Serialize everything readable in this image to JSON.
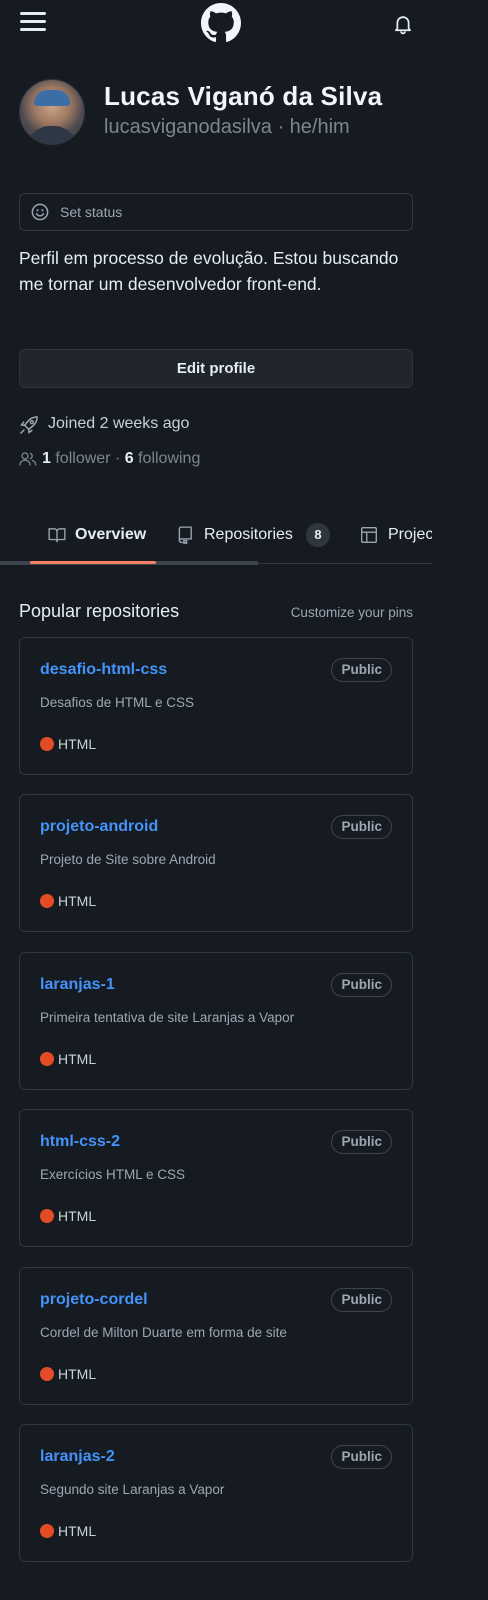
{
  "header": {
    "menu_icon": "hamburger-menu-icon",
    "logo_icon": "github-octocat-icon",
    "notifications_icon": "bell-icon"
  },
  "profile": {
    "name": "Lucas Viganó da Silva",
    "login_line": "lucasviganodasilva · he/him",
    "status_label": "Set status",
    "bio": "Perfil em processo de evolução. Estou buscando me tornar um desenvolvedor front-end.",
    "edit_button": "Edit profile",
    "joined": "Joined 2 weeks ago",
    "followers_count": "1",
    "followers_label": "follower",
    "following_count": "6",
    "following_label": "following"
  },
  "tabs": [
    {
      "label": "Overview",
      "icon": "book-icon",
      "selected": true
    },
    {
      "label": "Repositories",
      "icon": "repo-icon",
      "count": "8"
    },
    {
      "label": "Projec",
      "icon": "table-icon"
    }
  ],
  "popular": {
    "title": "Popular repositories",
    "customize": "Customize your pins",
    "repos": [
      {
        "name": "desafio-html-css",
        "visibility": "Public",
        "description": "Desafios de HTML e CSS",
        "language": "HTML"
      },
      {
        "name": "projeto-android",
        "visibility": "Public",
        "description": "Projeto de Site sobre Android",
        "language": "HTML"
      },
      {
        "name": "laranjas-1",
        "visibility": "Public",
        "description": "Primeira tentativa de site Laranjas a Vapor",
        "language": "HTML"
      },
      {
        "name": "html-css-2",
        "visibility": "Public",
        "description": "Exercícios HTML e CSS",
        "language": "HTML"
      },
      {
        "name": "projeto-cordel",
        "visibility": "Public",
        "description": "Cordel de Milton Duarte em forma de site",
        "language": "HTML"
      },
      {
        "name": "laranjas-2",
        "visibility": "Public",
        "description": "Segundo site Laranjas a Vapor",
        "language": "HTML"
      }
    ]
  },
  "colors": {
    "background": "#161b22",
    "link": "#4493f8",
    "html_language": "#e34c26",
    "tab_underline": "#f78166"
  }
}
